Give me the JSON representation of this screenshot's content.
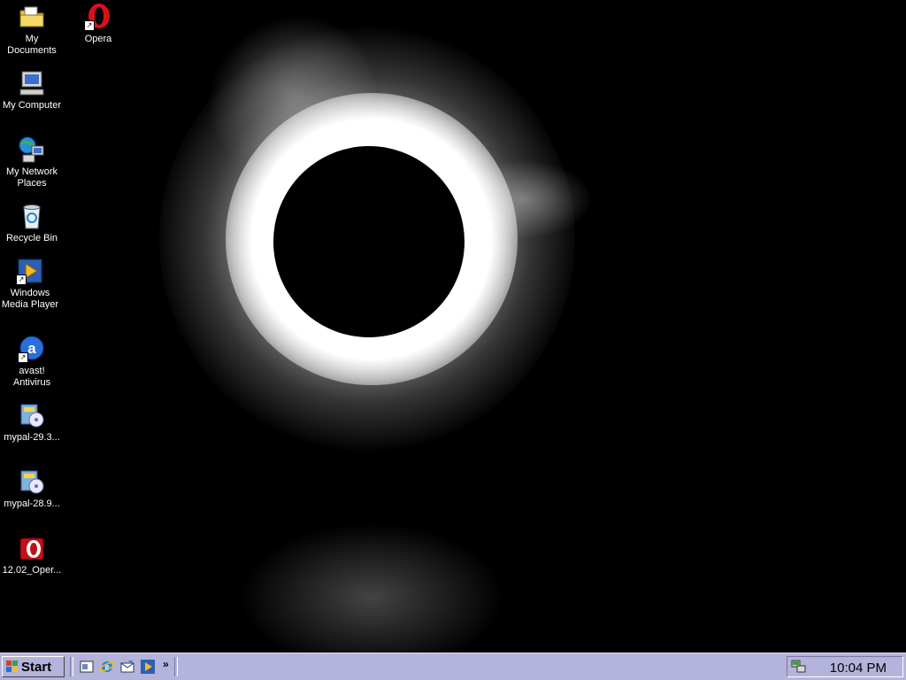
{
  "desktop": {
    "icons": [
      {
        "label": "My Documents",
        "icon": "folder-documents-icon"
      },
      {
        "label": "Opera",
        "icon": "opera-icon"
      },
      {
        "label": "My Computer",
        "icon": "computer-icon"
      },
      {
        "label": "My Network Places",
        "icon": "network-icon"
      },
      {
        "label": "Recycle Bin",
        "icon": "recycle-bin-icon"
      },
      {
        "label": "Windows Media Player",
        "icon": "media-player-icon"
      },
      {
        "label": "avast! Antivirus",
        "icon": "avast-icon"
      },
      {
        "label": "mypal-29.3...",
        "icon": "installer-icon"
      },
      {
        "label": "mypal-28.9...",
        "icon": "installer-icon"
      },
      {
        "label": "12.02_Oper...",
        "icon": "opera-installer-icon"
      }
    ]
  },
  "taskbar": {
    "start_label": "Start",
    "quick_launch": [
      "show-desktop-icon",
      "internet-explorer-icon",
      "outlook-express-icon",
      "media-player-icon"
    ],
    "chevron": "»",
    "clock": "10:04 PM"
  },
  "colors": {
    "taskbar": "#b3b3dc",
    "desktop_bg": "#000000"
  }
}
